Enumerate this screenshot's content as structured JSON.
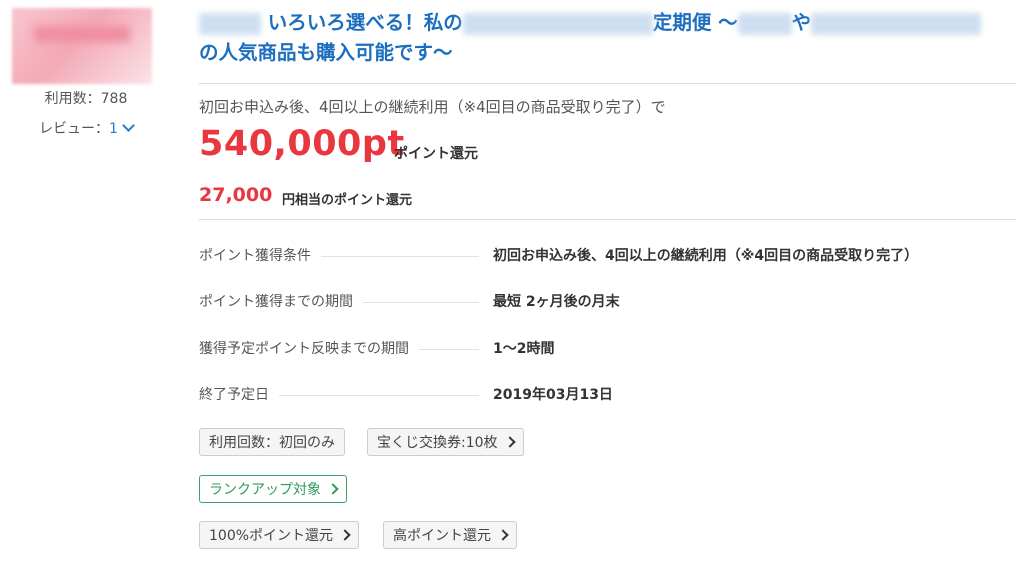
{
  "sidebar": {
    "usage_label": "利用数：",
    "usage_count": "788",
    "review_label": "レビュー：",
    "review_count": "1"
  },
  "offer": {
    "title_line1": "いろいろ選べる！私の",
    "title_mid": "定期便 〜",
    "title_ya": "や",
    "title_line2": "の人気商品も購入可能です〜",
    "condition_summary": "初回お申込み後、4回以上の継続利用（※4回目の商品受取り完了）で",
    "points": "540,000pt",
    "points_label": "ポイント還元",
    "yen_value": "27,000",
    "yen_label": "円相当のポイント還元"
  },
  "details": [
    {
      "label": "ポイント獲得条件",
      "value": "初回お申込み後、4回以上の継続利用（※4回目の商品受取り完了）"
    },
    {
      "label": "ポイント獲得までの期間",
      "value": "最短 2ヶ月後の月末"
    },
    {
      "label": "獲得予定ポイント反映までの期間",
      "value": "1〜2時間"
    },
    {
      "label": "終了予定日",
      "value": "2019年03月13日"
    }
  ],
  "tags": {
    "usage_times": "利用回数：初回のみ",
    "lottery": "宝くじ交換券:10枚",
    "rankup": "ランクアップ対象",
    "full_point": "100%ポイント還元",
    "high_point": "高ポイント還元"
  },
  "colors": {
    "accent_red": "#e8373e",
    "link_blue": "#1c6fbf",
    "green": "#2e9a5e"
  }
}
